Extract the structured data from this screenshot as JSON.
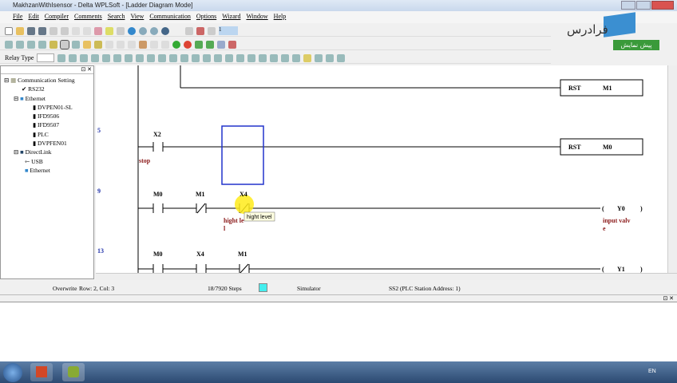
{
  "window": {
    "title": "MakhzanWithIsensor - Delta WPLSoft - [Ladder Diagram Mode]"
  },
  "menu": [
    "File",
    "Edit",
    "Compiler",
    "Comments",
    "Search",
    "View",
    "Communication",
    "Options",
    "Wizard",
    "Window",
    "Help"
  ],
  "toolbar": {
    "relay_type_label": "Relay Type",
    "step_value": "1"
  },
  "tree": {
    "root": "Communication Setting",
    "rs232": "RS232",
    "ethernet": "Ethernet",
    "eth_items": [
      "DVPEN01-SL",
      "IFD9506",
      "IFD9507",
      "PLC",
      "DVPFEN01"
    ],
    "directlink": "DirectLink",
    "usb": "USB",
    "ethernet2": "Ethernet"
  },
  "ladder": {
    "rung1": {
      "coil": "RST",
      "operand": "M1"
    },
    "rung5": {
      "num": "5",
      "contact": "X2",
      "comment": "stop",
      "coil": "RST",
      "operand": "M0"
    },
    "rung9": {
      "num": "9",
      "c1": "M0",
      "c2": "M1",
      "c3": "X4",
      "c3_comment1": "hight le",
      "c3_comment2": "l",
      "coil": "Y0",
      "coil_comment1": "input valv",
      "coil_comment2": "e",
      "tooltip": "hight level"
    },
    "rung13": {
      "num": "13",
      "c1": "M0",
      "c2": "X4",
      "c3": "M1",
      "coil": "Y1"
    },
    "paren_open": "(",
    "paren_close": ")"
  },
  "status": {
    "mode": "Overwrite",
    "position": "Row: 2, Col: 3",
    "steps": "18/7920 Steps",
    "sim": "Simulator",
    "station": "SS2 (PLC Station Address: 1)"
  },
  "logo": {
    "text": "فرادرس",
    "badge": "پیش نمایش"
  },
  "taskbar": {
    "lang": "EN"
  }
}
